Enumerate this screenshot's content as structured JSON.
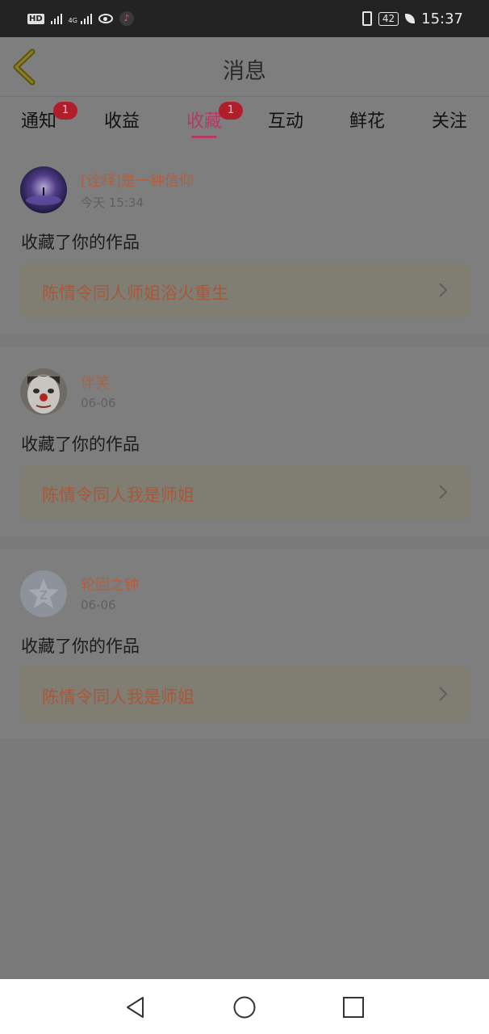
{
  "status_bar": {
    "left_icons": [
      "hd-icon",
      "signal-x-icon",
      "signal-4g-icon",
      "eye-icon",
      "tiktok-icon"
    ],
    "hd": "HD",
    "net": "4G",
    "battery": "42",
    "time": "15:37"
  },
  "header": {
    "title": "消息"
  },
  "tabs": [
    {
      "label": "通知",
      "badge": "1"
    },
    {
      "label": "收益",
      "badge": ""
    },
    {
      "label": "收藏",
      "badge": "1",
      "active": true
    },
    {
      "label": "互动",
      "badge": ""
    },
    {
      "label": "鲜花",
      "badge": ""
    },
    {
      "label": "关注",
      "badge": ""
    }
  ],
  "messages": [
    {
      "user": "[诠释]是一钟信仰",
      "time": "今天 15:34",
      "action": "收藏了你的作品",
      "work": "陈情令同人师姐浴火重生",
      "avatar": "moon-night-avatar"
    },
    {
      "user": "伴笑",
      "time": "06-06",
      "action": "收藏了你的作品",
      "work": "陈情令同人我是师姐",
      "avatar": "clown-face-avatar"
    },
    {
      "user": "轮回之钟",
      "time": "06-06",
      "action": "收藏了你的作品",
      "work": "陈情令同人我是师姐",
      "avatar": "default-star-avatar"
    }
  ],
  "colors": {
    "accent": "#b53a66",
    "badge": "#b01e2c",
    "username": "#b0603e",
    "overlay_bg": "#7a7a7a"
  }
}
